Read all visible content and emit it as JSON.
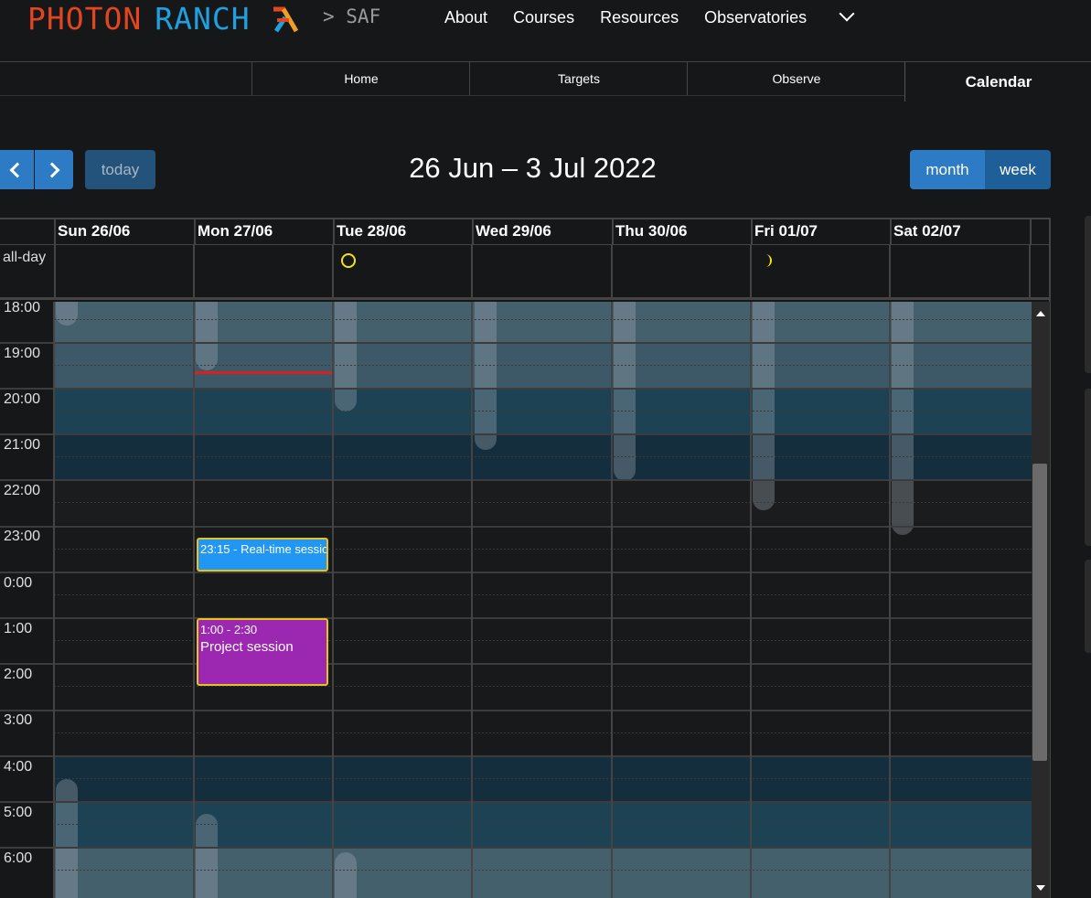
{
  "brand": {
    "part1": "PHOTON",
    "part2": "RANCH",
    "sub": "> SAF",
    "colors": {
      "photon": "#e3451f",
      "ranch": "#1fa0e0"
    }
  },
  "nav": {
    "about": "About",
    "courses": "Courses",
    "resources": "Resources",
    "observatories": "Observatories"
  },
  "tabs": {
    "home": "Home",
    "targets": "Targets",
    "observe": "Observe",
    "calendar": "Calendar"
  },
  "toolbar": {
    "today": "today",
    "title": "26 Jun – 3 Jul 2022",
    "month": "month",
    "week": "week"
  },
  "calendar": {
    "days": [
      "Sun 26/06",
      "Mon 27/06",
      "Tue 28/06",
      "Wed 29/06",
      "Thu 30/06",
      "Fri 01/07",
      "Sat 02/07"
    ],
    "allday_label": "all-day",
    "allday_icons": {
      "tue": "full-moon-icon",
      "fri": "crescent-moon-icon"
    },
    "hours": [
      "18:00",
      "19:00",
      "20:00",
      "21:00",
      "22:00",
      "23:00",
      "0:00",
      "1:00",
      "2:00",
      "3:00",
      "4:00",
      "5:00",
      "6:00"
    ],
    "events": [
      {
        "time": "23:15",
        "title": "Real-time session",
        "color": "#2196f3"
      },
      {
        "time": "1:00 - 2:30",
        "title": "Project session",
        "color": "#9c27b0"
      }
    ],
    "now_indicator_color": "#d92020"
  }
}
